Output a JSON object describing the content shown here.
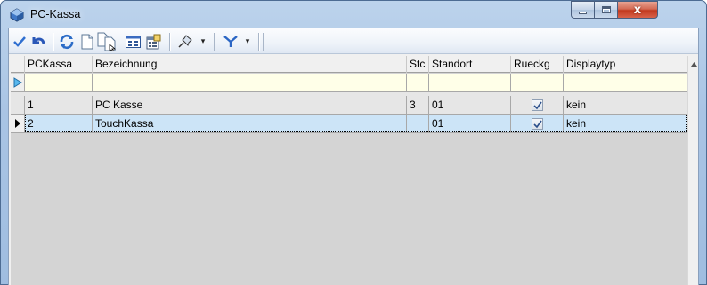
{
  "window": {
    "title": "PC-Kassa",
    "min_glyph": "minimize",
    "max_glyph": "maximize",
    "close_glyph": "x"
  },
  "toolbar": {
    "items": [
      {
        "name": "confirm-check-icon"
      },
      {
        "name": "undo-icon"
      },
      {
        "name": "refresh-icon"
      },
      {
        "name": "new-document-icon"
      },
      {
        "name": "copy-document-icon"
      },
      {
        "name": "form-view-icon"
      },
      {
        "name": "properties-icon"
      },
      {
        "name": "pin-icon"
      },
      {
        "name": "filter-icon"
      }
    ],
    "dropdown_caret": "▾"
  },
  "grid": {
    "columns": [
      "PCKassa",
      "Bezeichnung",
      "Stc",
      "Standort",
      "Rueckg",
      "Displaytyp"
    ],
    "rows": [
      {
        "PCKassa": "1",
        "Bezeichnung": "PC Kasse",
        "Stc": "3",
        "Standort": "01",
        "Rueckg": true,
        "Displaytyp": "kein"
      },
      {
        "PCKassa": "2",
        "Bezeichnung": "TouchKassa",
        "Stc": "",
        "Standort": "01",
        "Rueckg": true,
        "Displaytyp": "kein"
      }
    ],
    "selected_row": 1
  },
  "colors": {
    "selected_row": "#cce4f7",
    "new_row": "#ffffe8",
    "grid_background": "#d4d4d4",
    "close_button": "#c2391e",
    "accent": "#2a6fd6"
  }
}
